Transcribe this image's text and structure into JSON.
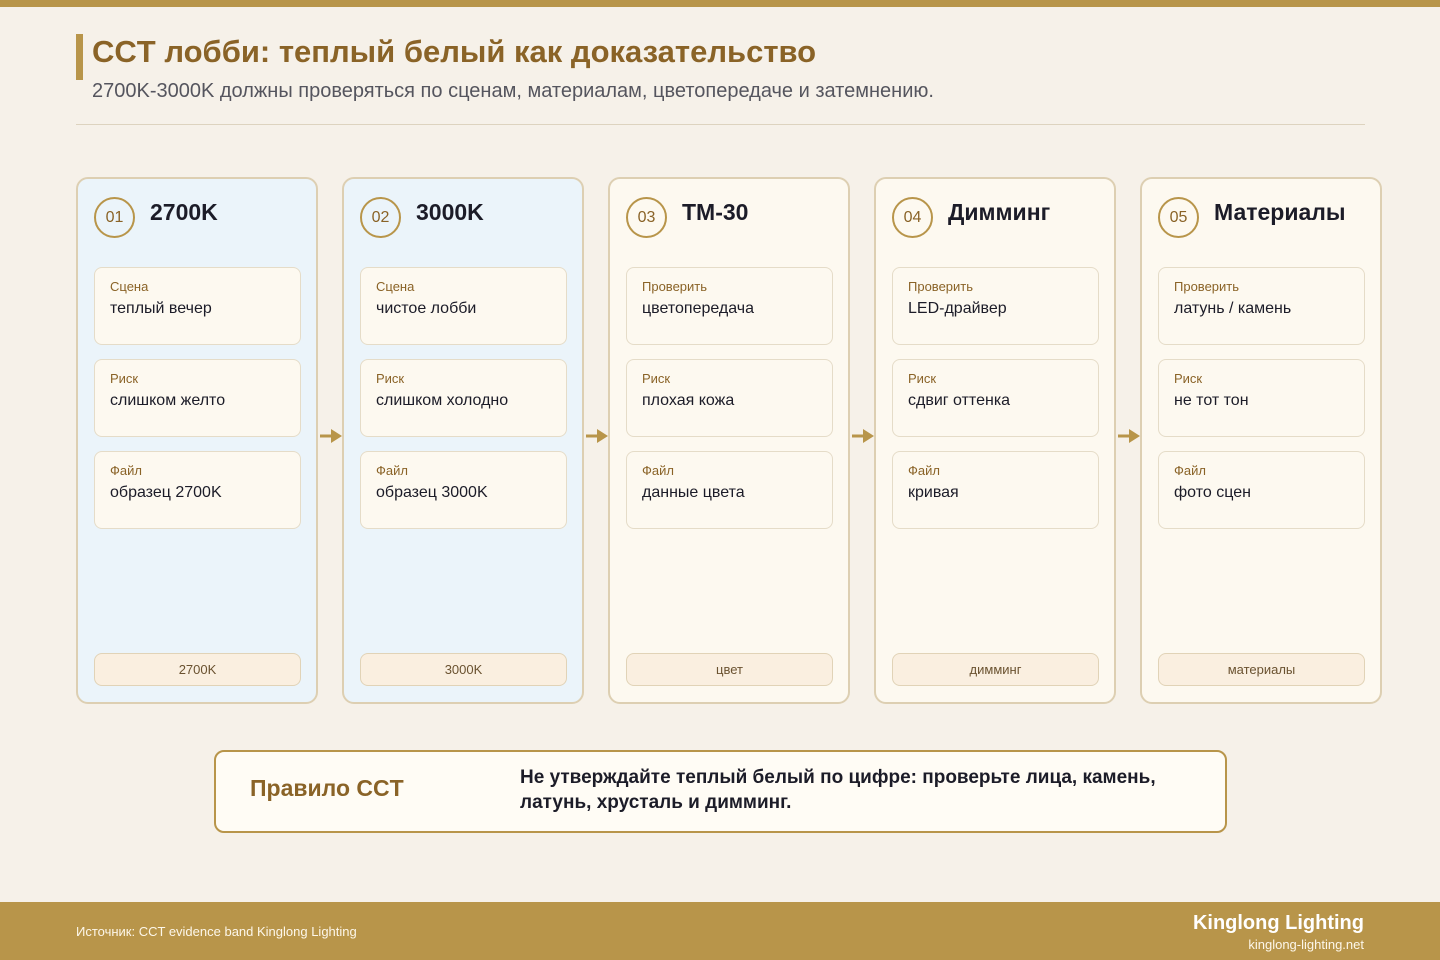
{
  "header": {
    "title": "CCT лобби: теплый белый как доказательство",
    "subtitle": "2700K-3000K должны проверяться по сценам, материалам, цветопередаче и затемнению."
  },
  "colors": {
    "accent": "#b8954a",
    "accent_text": "#8a6327",
    "card_blue": "#ebf4fa",
    "card_cream": "#fdf9f0"
  },
  "cards": [
    {
      "num": "01",
      "title": "2700K",
      "fields": [
        {
          "label": "Сцена",
          "value": "теплый вечер"
        },
        {
          "label": "Риск",
          "value": "слишком желто"
        },
        {
          "label": "Файл",
          "value": "образец 2700K"
        }
      ],
      "tag": "2700K"
    },
    {
      "num": "02",
      "title": "3000K",
      "fields": [
        {
          "label": "Сцена",
          "value": "чистое лобби"
        },
        {
          "label": "Риск",
          "value": "слишком холодно"
        },
        {
          "label": "Файл",
          "value": "образец 3000K"
        }
      ],
      "tag": "3000K"
    },
    {
      "num": "03",
      "title": "TM-30",
      "fields": [
        {
          "label": "Проверить",
          "value": "цветопередача"
        },
        {
          "label": "Риск",
          "value": "плохая кожа"
        },
        {
          "label": "Файл",
          "value": "данные цвета"
        }
      ],
      "tag": "цвет"
    },
    {
      "num": "04",
      "title": "Димминг",
      "fields": [
        {
          "label": "Проверить",
          "value": "LED-драйвер"
        },
        {
          "label": "Риск",
          "value": "сдвиг оттенка"
        },
        {
          "label": "Файл",
          "value": "кривая"
        }
      ],
      "tag": "димминг"
    },
    {
      "num": "05",
      "title": "Материалы",
      "fields": [
        {
          "label": "Проверить",
          "value": "латунь / камень"
        },
        {
          "label": "Риск",
          "value": "не тот тон"
        },
        {
          "label": "Файл",
          "value": "фото сцен"
        }
      ],
      "tag": "материалы"
    }
  ],
  "rule": {
    "label": "Правило CCT",
    "text": "Не утверждайте теплый белый по цифре: проверьте лица, камень, латунь, хрусталь и димминг."
  },
  "footer": {
    "source": "Источник: CCT evidence band Kinglong Lighting",
    "brand": "Kinglong Lighting",
    "site": "kinglong-lighting.net"
  }
}
